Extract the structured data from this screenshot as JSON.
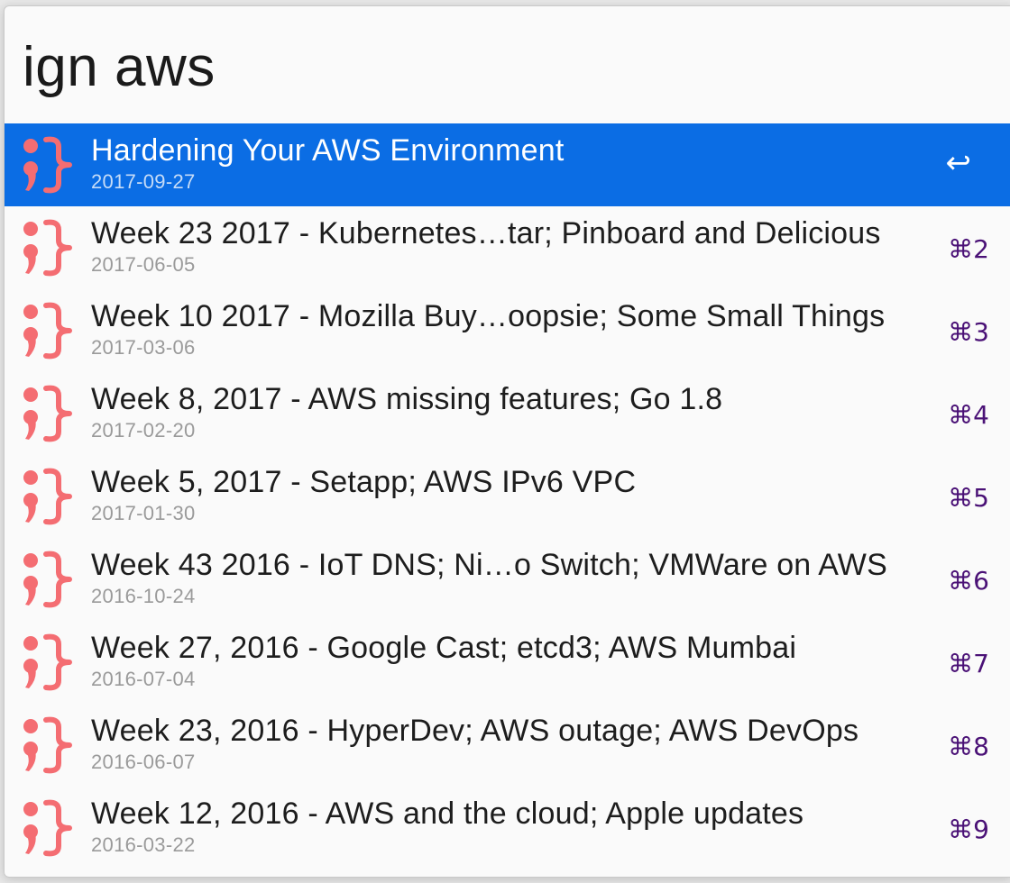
{
  "search": {
    "query": "ign aws"
  },
  "icon": {
    "name": "semicolon-brace-icon",
    "color": "#f46d72"
  },
  "colors": {
    "selection": "#0b6de4",
    "shortcut": "#4a1176",
    "subtitle": "#9a9a9a"
  },
  "results": [
    {
      "title": "Hardening Your AWS Environment",
      "subtitle": "2017-09-27",
      "shortcut": "↩"
    },
    {
      "title": "Week 23 2017 - Kubernetes…tar; Pinboard and Delicious",
      "subtitle": "2017-06-05",
      "shortcut": "⌘2"
    },
    {
      "title": "Week 10 2017 - Mozilla Buy…oopsie; Some Small Things",
      "subtitle": "2017-03-06",
      "shortcut": "⌘3"
    },
    {
      "title": "Week 8, 2017 - AWS missing features; Go 1.8",
      "subtitle": "2017-02-20",
      "shortcut": "⌘4"
    },
    {
      "title": "Week 5, 2017 - Setapp; AWS IPv6 VPC",
      "subtitle": "2017-01-30",
      "shortcut": "⌘5"
    },
    {
      "title": "Week 43 2016 - IoT DNS; Ni…o Switch; VMWare on AWS",
      "subtitle": "2016-10-24",
      "shortcut": "⌘6"
    },
    {
      "title": "Week 27, 2016 - Google Cast; etcd3; AWS Mumbai",
      "subtitle": "2016-07-04",
      "shortcut": "⌘7"
    },
    {
      "title": "Week 23, 2016 - HyperDev; AWS outage; AWS DevOps",
      "subtitle": "2016-06-07",
      "shortcut": "⌘8"
    },
    {
      "title": "Week 12, 2016 - AWS and the cloud; Apple updates",
      "subtitle": "2016-03-22",
      "shortcut": "⌘9"
    }
  ]
}
